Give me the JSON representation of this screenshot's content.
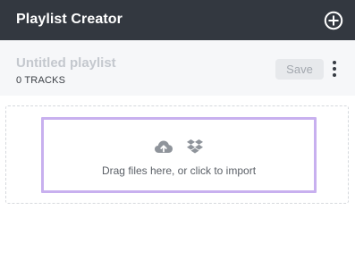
{
  "app": {
    "title": "Playlist Creator",
    "add_icon": "plus-circle-icon"
  },
  "playlist": {
    "name": "Untitled playlist",
    "track_count": "0 TRACKS",
    "save_label": "Save",
    "more_icon": "kebab-menu-icon"
  },
  "dropzone": {
    "hint": "Drag files here, or click to import",
    "icons": [
      "cloud-upload-icon",
      "dropbox-icon"
    ]
  },
  "colors": {
    "topbar": "#333840",
    "accent_border": "#c8b0ef",
    "placeholder_text": "#c4c8ce",
    "save_button_bg": "#e7e9ec"
  }
}
